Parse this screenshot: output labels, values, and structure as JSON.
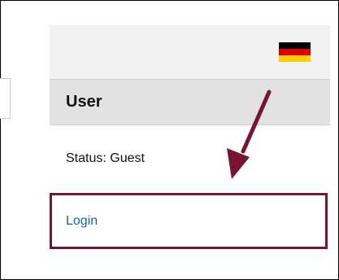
{
  "panel": {
    "header_title": "User",
    "status_text": "Status: Guest",
    "login_label": "Login",
    "language_flag": {
      "icon": "german-flag-icon",
      "colors": [
        "#000000",
        "#dd0000",
        "#ffce00"
      ]
    }
  },
  "annotation": {
    "arrow_color": "#7a1431"
  },
  "colors": {
    "header_bg": "#e2e2e2",
    "flag_bar_bg": "#f2f2f2",
    "link": "#1a5fb4",
    "highlight_border": "#7a1431"
  }
}
